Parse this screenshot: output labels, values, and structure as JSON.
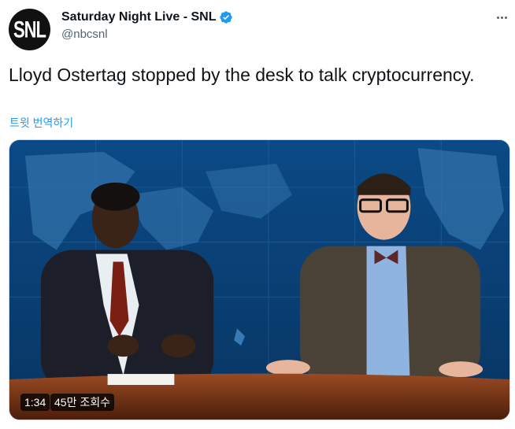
{
  "author": {
    "display_name": "Saturday Night Live - SNL",
    "handle": "@nbcsnl",
    "avatar_text": "SNL",
    "verified": true,
    "verified_color": "#1d9bf0"
  },
  "tweet": {
    "text": "Lloyd Ostertag stopped by the desk to talk cryptocurrency.",
    "translate_label": "트윗 번역하기"
  },
  "video": {
    "duration": "1:34",
    "views": "45만 조회수"
  },
  "icons": {
    "more": "more-horizontal-icon",
    "verified": "verified-badge-icon"
  }
}
